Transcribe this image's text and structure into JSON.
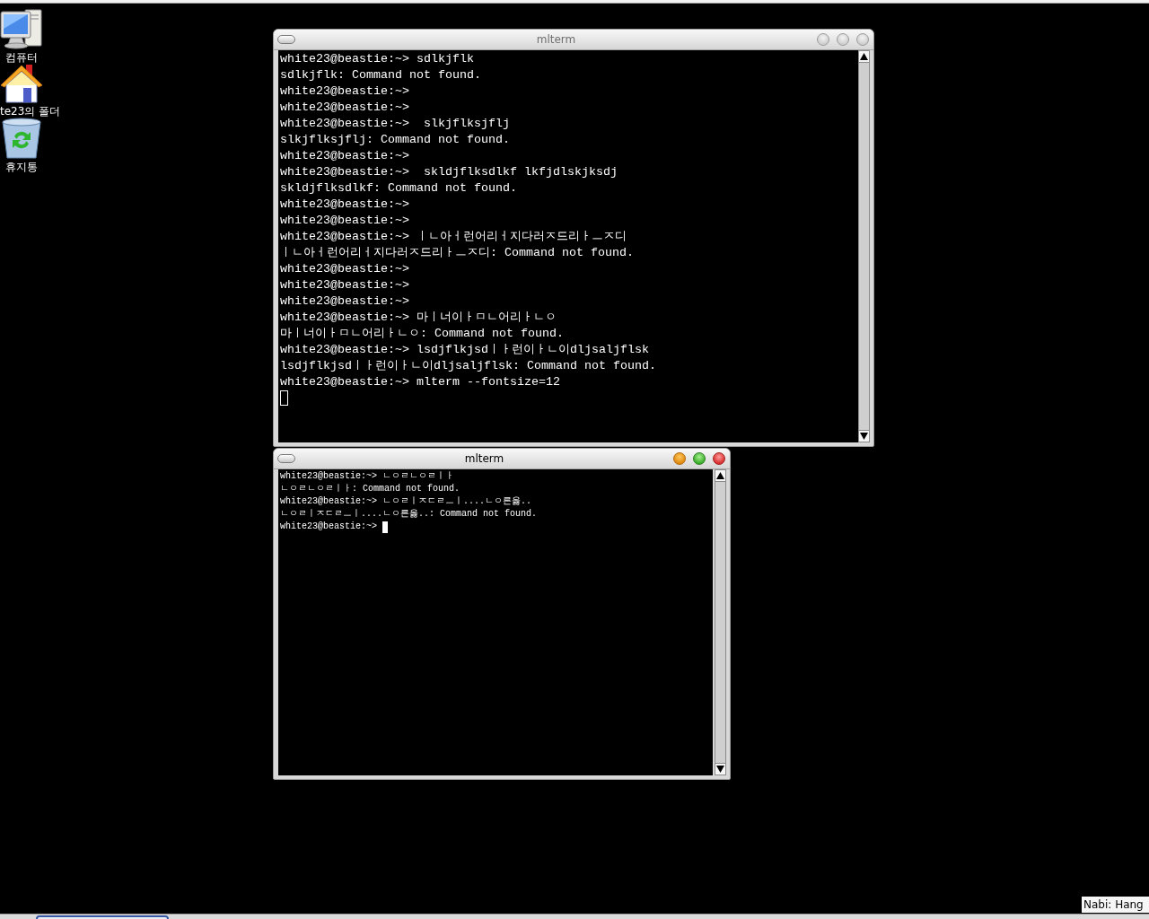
{
  "desktop_icons": [
    {
      "kind": "computer",
      "label": "컴퓨터"
    },
    {
      "kind": "home",
      "label": "te23의 폴더"
    },
    {
      "kind": "trash",
      "label": "휴지통"
    }
  ],
  "windows": [
    {
      "title": "mlterm",
      "active": false,
      "cursor_on_new_line": true,
      "lines": [
        "white23@beastie:~> sdlkjflk",
        "sdlkjflk: Command not found.",
        "white23@beastie:~>",
        "white23@beastie:~>",
        "white23@beastie:~>  slkjflksjflj",
        "slkjflksjflj: Command not found.",
        "white23@beastie:~>",
        "white23@beastie:~>  skldjflksdlkf lkfjdlskjksdj",
        "skldjflksdlkf: Command not found.",
        "white23@beastie:~>",
        "white23@beastie:~>",
        "white23@beastie:~> ㅣㄴ아ㅓ런어리ㅓ지다러ㅈ드리ㅏㅡㅈ디",
        "ㅣㄴ아ㅓ런어리ㅓ지다러ㅈ드리ㅏㅡㅈ디: Command not found.",
        "white23@beastie:~>",
        "white23@beastie:~>",
        "white23@beastie:~>",
        "white23@beastie:~> 마ㅣ너이ㅏㅁㄴ어리ㅏㄴㅇ",
        "마ㅣ너이ㅏㅁㄴ어리ㅏㄴㅇ: Command not found.",
        "white23@beastie:~> lsdjflkjsdㅣㅏ런이ㅏㄴ이dljsaljflsk",
        "lsdjflkjsdㅣㅏ런이ㅏㄴ이dljsaljflsk: Command not found.",
        "white23@beastie:~> mlterm --fontsize=12"
      ]
    },
    {
      "title": "mlterm",
      "active": true,
      "cursor_on_new_line": false,
      "lines": [
        "white23@beastie:~> ㄴㅇㄹㄴㅇㄹㅣㅏ",
        "ㄴㅇㄹㄴㅇㄹㅣㅏ: Command not found.",
        "white23@beastie:~> ㄴㅇㄹㅣㅈㄷㄹㅡㅣ....ㄴㅇ른옳..",
        "ㄴㅇㄹㅣㅈㄷㄹㅡㅣ....ㄴㅇ른옳..: Command not found.",
        "white23@beastie:~>"
      ]
    }
  ],
  "tooltip": {
    "text": "Nabi: Hang"
  }
}
